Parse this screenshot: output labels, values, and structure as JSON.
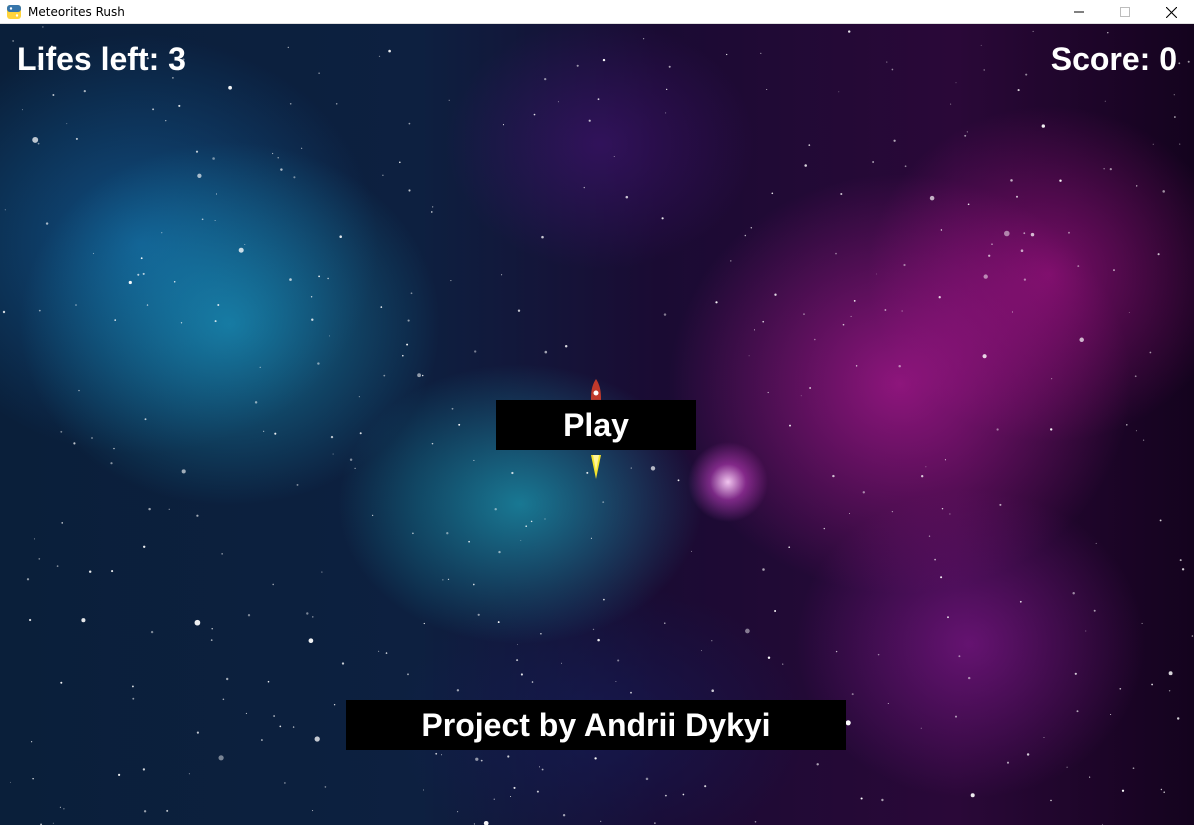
{
  "window": {
    "title": "Meteorites Rush",
    "app_icon": "python-icon",
    "controls": [
      "minimize-icon",
      "maximize-icon",
      "close-icon"
    ]
  },
  "hud": {
    "lifes_label": "Lifes left:",
    "lifes_value": "3",
    "score_label": "Score:",
    "score_value": "0"
  },
  "menu": {
    "play_label": "Play",
    "credits_label": "Project by Andrii Dykyi"
  },
  "colors": {
    "text": "#ffffff",
    "button_bg": "#000000",
    "nebula_cyan": "#1eb4dc",
    "nebula_magenta": "#d21eaa"
  },
  "sprites": {
    "player": "rocket-icon"
  }
}
